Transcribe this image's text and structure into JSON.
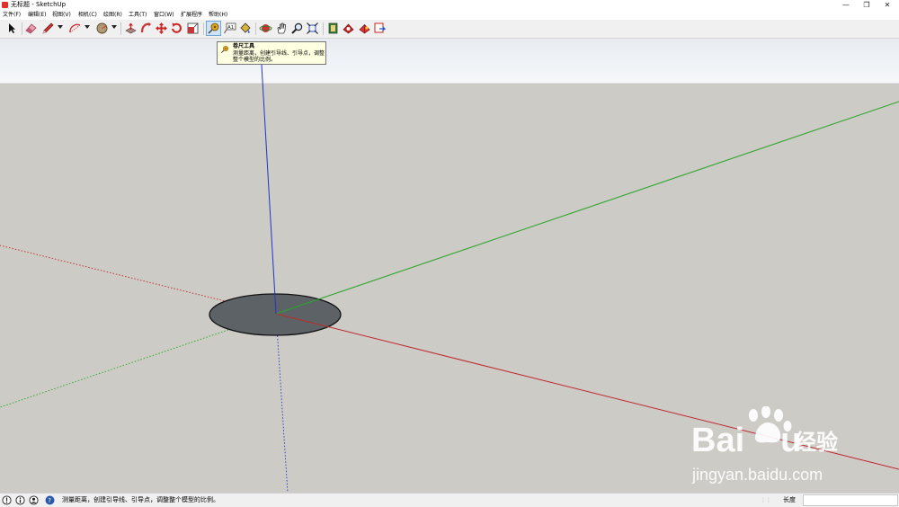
{
  "window": {
    "title": "无标题 - SketchUp",
    "minimize": "—",
    "restore": "❐",
    "close": "✕"
  },
  "menu": {
    "items": [
      {
        "label": "文件(F)"
      },
      {
        "label": "编辑(E)"
      },
      {
        "label": "视图(V)"
      },
      {
        "label": "相机(C)"
      },
      {
        "label": "绘图(R)"
      },
      {
        "label": "工具(T)"
      },
      {
        "label": "窗口(W)"
      },
      {
        "label": "扩展程序"
      },
      {
        "label": "帮助(H)"
      }
    ]
  },
  "toolbar": {
    "tools": [
      {
        "name": "select-tool",
        "icon": "arrow-cursor-icon"
      },
      {
        "name": "eraser-tool",
        "icon": "eraser-icon"
      },
      {
        "name": "pencil-tool",
        "icon": "pencil-icon"
      },
      {
        "name": "arc-tool",
        "icon": "arc-icon"
      },
      {
        "name": "shape-tool",
        "icon": "circle-shape-icon"
      },
      {
        "name": "push-pull-tool",
        "icon": "push-pull-icon"
      },
      {
        "name": "follow-me-tool",
        "icon": "follow-me-icon"
      },
      {
        "name": "move-tool",
        "icon": "move-arrows-icon"
      },
      {
        "name": "rotate-tool",
        "icon": "rotate-icon"
      },
      {
        "name": "scale-tool",
        "icon": "scale-icon"
      },
      {
        "name": "tape-measure-tool",
        "icon": "tape-measure-icon",
        "active": true
      },
      {
        "name": "text-tool",
        "icon": "text-label-icon"
      },
      {
        "name": "paint-bucket-tool",
        "icon": "paint-bucket-icon"
      },
      {
        "name": "orbit-tool",
        "icon": "orbit-icon"
      },
      {
        "name": "pan-tool",
        "icon": "hand-pan-icon"
      },
      {
        "name": "zoom-tool",
        "icon": "magnifier-icon"
      },
      {
        "name": "zoom-extents-tool",
        "icon": "zoom-extents-icon"
      },
      {
        "name": "3d-warehouse-tool",
        "icon": "warehouse-icon"
      },
      {
        "name": "extension-warehouse-tool",
        "icon": "extension-icon"
      },
      {
        "name": "layout-tool",
        "icon": "layout-icon"
      },
      {
        "name": "send-to-layout-tool",
        "icon": "send-icon"
      }
    ]
  },
  "tooltip": {
    "title": "卷尺工具",
    "description": "测量距离，创建引导线、引导点，调整整个模型的比例。"
  },
  "statusbar": {
    "icons": [
      "geo-location-icon",
      "info-icon",
      "user-icon",
      "help-icon"
    ],
    "message": "测量距离，创建引导线、引导点，调整整个模型的比例。",
    "measurement_label": "长度",
    "measurement_value": ""
  },
  "watermark": {
    "brand_latin": "Bai",
    "brand_latin_end": "u",
    "brand_cn": "经验",
    "url": "jingyan.baidu.com"
  },
  "colors": {
    "sky": "#f2f5f8",
    "ground": "#cccbc5",
    "red_axis": "#c0282a",
    "green_axis": "#2aa52a",
    "blue_axis": "#2233cc",
    "disc": "#5d6266",
    "accent_active": "#cfe3f7"
  }
}
